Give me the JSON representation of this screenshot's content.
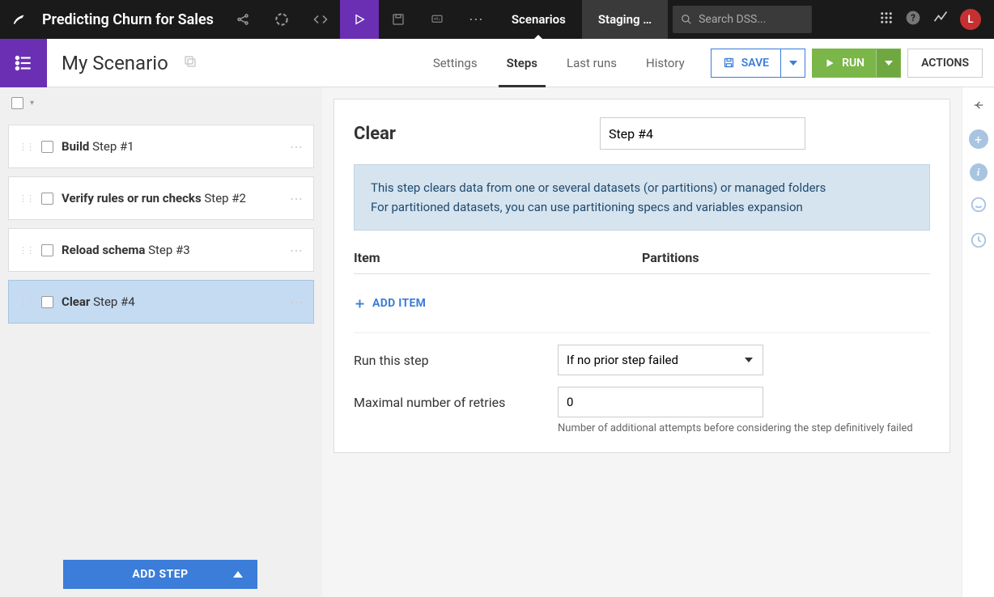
{
  "topbar": {
    "title": "Predicting Churn for Sales",
    "nav": {
      "scenarios": "Scenarios",
      "staging": "Staging …"
    },
    "search_placeholder": "Search DSS...",
    "avatar": "L"
  },
  "subheader": {
    "page_title": "My Scenario",
    "tabs": {
      "settings": "Settings",
      "steps": "Steps",
      "last_runs": "Last runs",
      "history": "History"
    },
    "buttons": {
      "save": "SAVE",
      "run": "RUN",
      "actions": "ACTIONS"
    }
  },
  "steps": [
    {
      "name": "Build",
      "suffix": "Step #1",
      "selected": false
    },
    {
      "name": "Verify rules or run checks",
      "suffix": "Step #2",
      "selected": false
    },
    {
      "name": "Reload schema",
      "suffix": "Step #3",
      "selected": false
    },
    {
      "name": "Clear",
      "suffix": "Step #4",
      "selected": true
    }
  ],
  "add_step_label": "ADD STEP",
  "detail": {
    "type": "Clear",
    "name_value": "Step #4",
    "info_line1": "This step clears data from one or several datasets (or partitions) or managed folders",
    "info_line2": "For partitioned datasets, you can use partitioning specs and variables expansion",
    "items_header": {
      "item": "Item",
      "partitions": "Partitions"
    },
    "add_item": "ADD ITEM",
    "run_this_step_label": "Run this step",
    "run_this_step_value": "If no prior step failed",
    "retries_label": "Maximal number of retries",
    "retries_value": "0",
    "retries_help": "Number of additional attempts before considering the step definitively failed"
  }
}
